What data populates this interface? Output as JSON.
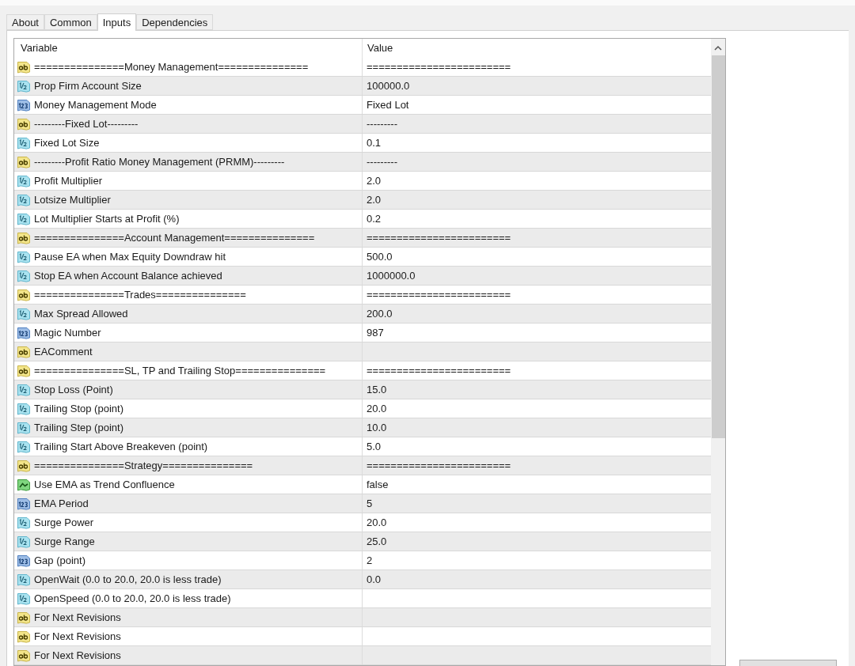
{
  "tabs": [
    {
      "label": "About",
      "selected": false
    },
    {
      "label": "Common",
      "selected": false
    },
    {
      "label": "Inputs",
      "selected": true
    },
    {
      "label": "Dependencies",
      "selected": false
    }
  ],
  "table": {
    "columns": [
      "Variable",
      "Value"
    ],
    "rows": [
      {
        "kind": "string",
        "variable": "===============Money Management===============",
        "value": "========================"
      },
      {
        "kind": "double",
        "variable": "Prop Firm Account Size",
        "value": "100000.0"
      },
      {
        "kind": "integer",
        "variable": "Money Management Mode",
        "value": "Fixed Lot"
      },
      {
        "kind": "string",
        "variable": "---------Fixed Lot---------",
        "value": "---------"
      },
      {
        "kind": "double",
        "variable": "Fixed Lot Size",
        "value": "0.1"
      },
      {
        "kind": "string",
        "variable": "---------Profit Ratio Money Management (PRMM)---------",
        "value": "---------"
      },
      {
        "kind": "double",
        "variable": "Profit  Multiplier",
        "value": "2.0"
      },
      {
        "kind": "double",
        "variable": "Lotsize Multiplier",
        "value": "2.0"
      },
      {
        "kind": "double",
        "variable": "Lot Multiplier Starts at Profit (%)",
        "value": "0.2"
      },
      {
        "kind": "string",
        "variable": "===============Account Management===============",
        "value": "========================"
      },
      {
        "kind": "double",
        "variable": "Pause EA when Max Equity Downdraw hit",
        "value": "500.0"
      },
      {
        "kind": "double",
        "variable": "Stop EA when Account Balance achieved",
        "value": "1000000.0"
      },
      {
        "kind": "string",
        "variable": "===============Trades===============",
        "value": "========================"
      },
      {
        "kind": "double",
        "variable": "Max Spread Allowed",
        "value": "200.0"
      },
      {
        "kind": "integer",
        "variable": "Magic Number",
        "value": "987"
      },
      {
        "kind": "string",
        "variable": "EAComment"
      },
      {
        "kind": "string",
        "variable": "===============SL, TP and Trailing Stop===============",
        "value": "========================"
      },
      {
        "kind": "double",
        "variable": "Stop Loss (Point)",
        "value": "15.0"
      },
      {
        "kind": "double",
        "variable": "Trailing Stop (point)",
        "value": "20.0"
      },
      {
        "kind": "double",
        "variable": "Trailing Step (point)",
        "value": "10.0"
      },
      {
        "kind": "double",
        "variable": "Trailing Start Above Breakeven (point)",
        "value": "5.0"
      },
      {
        "kind": "string",
        "variable": "===============Strategy===============",
        "value": "========================"
      },
      {
        "kind": "bool",
        "variable": "Use EMA as Trend Confluence",
        "value": "false"
      },
      {
        "kind": "integer",
        "variable": "EMA Period",
        "value": "5"
      },
      {
        "kind": "double",
        "variable": "Surge Power",
        "value": "20.0"
      },
      {
        "kind": "double",
        "variable": "Surge Range",
        "value": "25.0"
      },
      {
        "kind": "integer",
        "variable": "Gap (point)",
        "value": "2"
      },
      {
        "kind": "double",
        "variable": "OpenWait (0.0 to 20.0, 20.0 is less trade)",
        "value": "0.0"
      },
      {
        "kind": "double",
        "variable": "OpenSpeed (0.0 to 20.0, 20.0 is less trade)"
      },
      {
        "kind": "string",
        "variable": "For Next Revisions"
      },
      {
        "kind": "string",
        "variable": "For Next Revisions"
      },
      {
        "kind": "string",
        "variable": "For Next Revisions"
      }
    ]
  }
}
